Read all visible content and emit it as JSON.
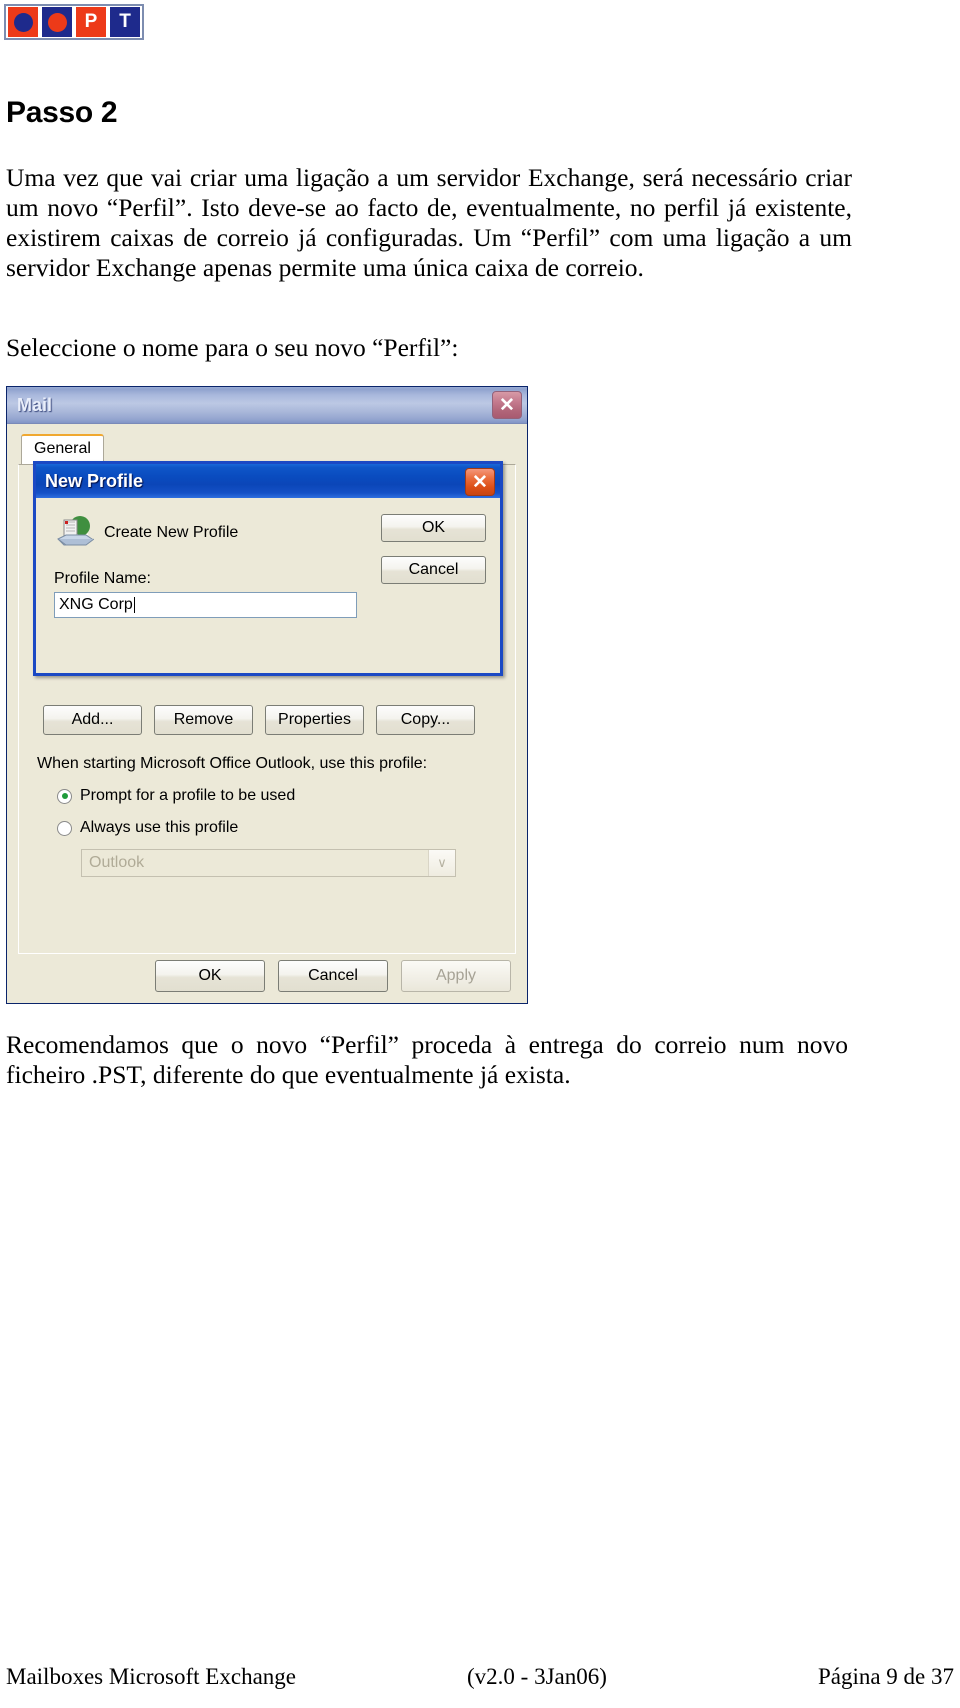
{
  "logo": {
    "name": "pt-logo",
    "squares": [
      {
        "type": "circle",
        "bg": "#ed3a19",
        "fg": "#1e2a8c",
        "text": ""
      },
      {
        "type": "circle",
        "bg": "#1e2a8c",
        "fg": "#ed3a19",
        "text": ""
      },
      {
        "type": "letter",
        "bg": "#ed3a19",
        "fg": "#ffffff",
        "text": "P"
      },
      {
        "type": "letter",
        "bg": "#1e2a8c",
        "fg": "#ffffff",
        "text": "T"
      }
    ]
  },
  "document": {
    "heading": "Passo 2",
    "paragraph1": "Uma vez que vai criar uma ligação a um servidor Exchange, será necessário criar um novo “Perfil”. Isto deve-se ao facto de, eventualmente, no perfil já existente, existirem caixas de correio já configuradas. Um “Perfil” com uma ligação a um servidor Exchange apenas permite uma única caixa de correio.",
    "paragraph2": "Seleccione o nome para o seu novo “Perfil”:",
    "paragraph3": "Recomendamos que o novo “Perfil” proceda à entrega do correio num novo ficheiro .PST, diferente do que eventualmente já exista."
  },
  "mail_dialog": {
    "title": "Mail",
    "close_label": "✕",
    "tab": "General",
    "buttons": {
      "add": "Add...",
      "remove": "Remove",
      "properties": "Properties",
      "copy": "Copy..."
    },
    "startup_label": "When starting Microsoft Office Outlook, use this profile:",
    "radios": [
      {
        "label": "Prompt for a profile to be used",
        "selected": true
      },
      {
        "label": "Always use this profile",
        "selected": false
      }
    ],
    "profile_combo": {
      "value": "Outlook",
      "arrow": "∨",
      "enabled": false
    },
    "footer_buttons": {
      "ok": "OK",
      "cancel": "Cancel",
      "apply": "Apply"
    }
  },
  "new_profile_dialog": {
    "title": "New Profile",
    "close_label": "✕",
    "create_label": "Create New Profile",
    "name_label": "Profile Name:",
    "name_value": "XNG Corp",
    "ok": "OK",
    "cancel": "Cancel"
  },
  "page_footer": {
    "left": "Mailboxes Microsoft Exchange",
    "middle": "(v2.0 - 3Jan06)",
    "right": "Página 9 de 37"
  },
  "colors": {
    "accent_orange": "#ed3a19",
    "accent_blue": "#1e2a8c",
    "dialog_face": "#ece9d8",
    "active_title": "#0a4cc0",
    "radio_green": "#1f9b3a"
  }
}
